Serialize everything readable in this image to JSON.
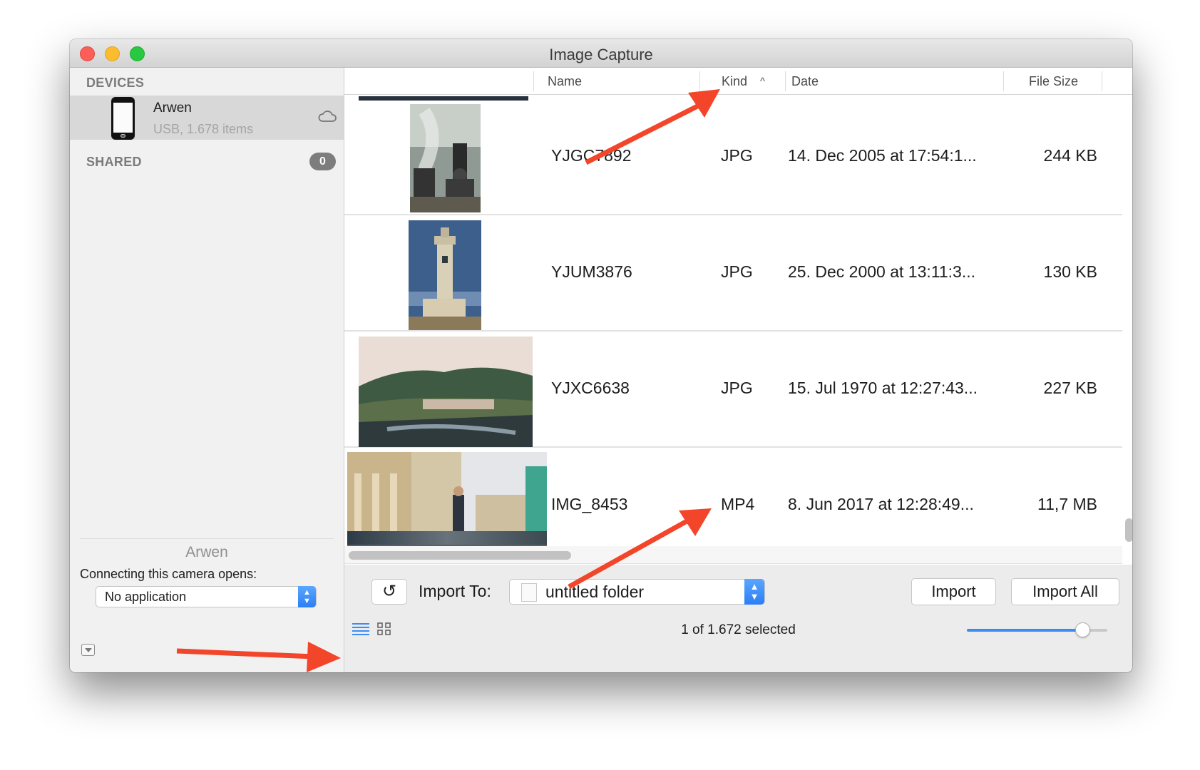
{
  "window": {
    "title": "Image Capture"
  },
  "sidebar": {
    "devices_header": "DEVICES",
    "device": {
      "name": "Arwen",
      "detail": "USB, 1.678 items",
      "icon": "iphone-icon"
    },
    "shared_header": "SHARED",
    "shared_count": "0",
    "camera_name": "Arwen",
    "camera_opens_label": "Connecting this camera opens:",
    "camera_opens_value": "No application"
  },
  "columns": {
    "name": "Name",
    "kind": "Kind",
    "date": "Date",
    "file_size": "File Size",
    "sort_indicator": "^"
  },
  "files": [
    {
      "name": "YJGC7892",
      "kind": "JPG",
      "date": "14. Dec 2005 at 17:54:1...",
      "size": "244 KB"
    },
    {
      "name": "YJUM3876",
      "kind": "JPG",
      "date": "25. Dec 2000 at 13:11:3...",
      "size": "130 KB"
    },
    {
      "name": "YJXC6638",
      "kind": "JPG",
      "date": "15. Jul 1970 at 12:27:43...",
      "size": "227 KB"
    },
    {
      "name": "IMG_8453",
      "kind": "MP4",
      "date": "8. Jun 2017 at 12:28:49...",
      "size": "11,7 MB"
    }
  ],
  "bottom_bar": {
    "rotate_label": "↺",
    "import_to_label": "Import To:",
    "folder_value": "untitled folder",
    "import_label": "Import",
    "import_all_label": "Import All",
    "selection_status": "1 of 1.672 selected",
    "thumbnail_size_level": 0.82
  },
  "colors": {
    "accent": "#3c8cf5",
    "annotation_arrow": "#f2452a"
  }
}
